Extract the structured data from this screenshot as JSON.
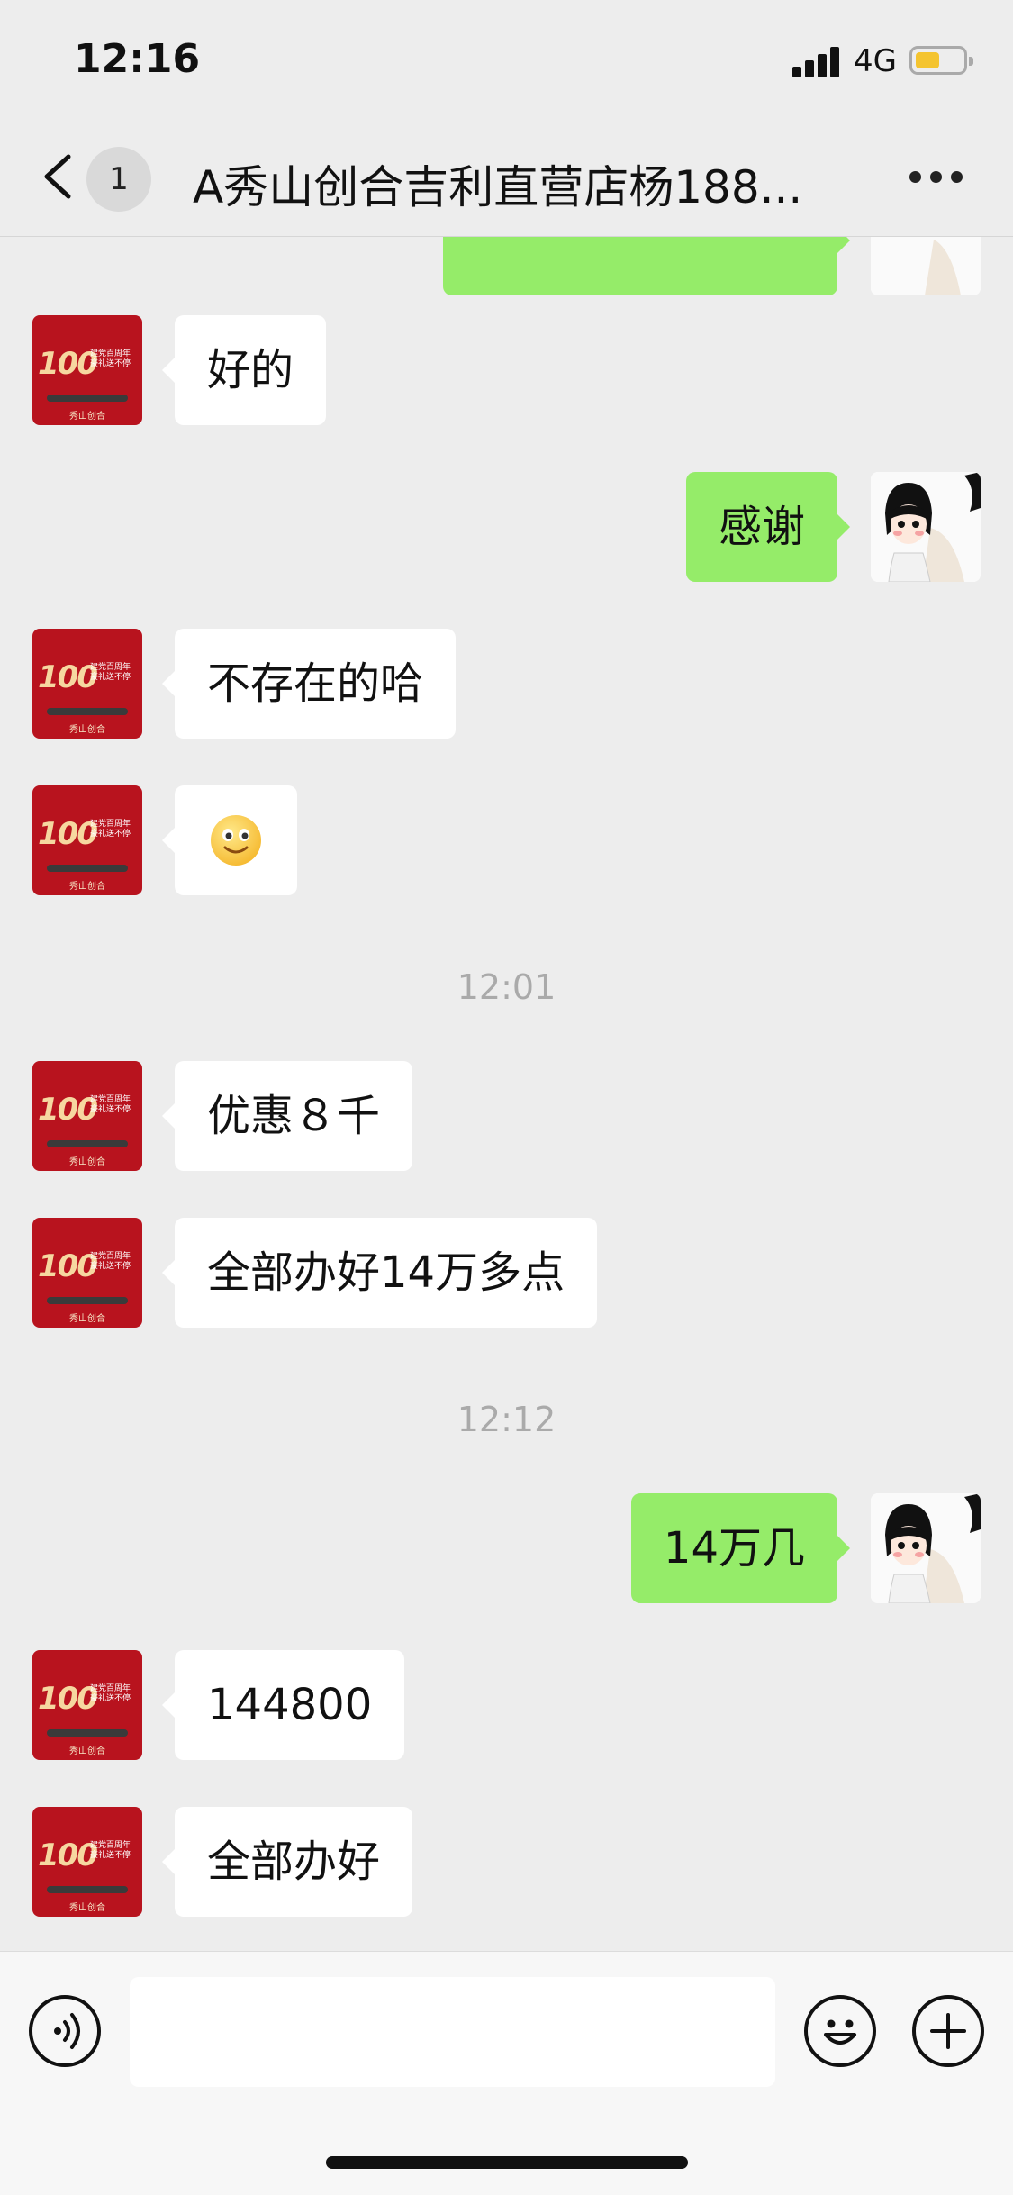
{
  "status_bar": {
    "time": "12:16",
    "network": "4G",
    "battery_level": 0.5
  },
  "header": {
    "unread_count": "1",
    "title": "A秀山创合吉利直营店杨188..."
  },
  "store_avatar": {
    "logo_number": "100",
    "tagline": "建党百周年 豪礼送不停",
    "footer": "秀山创合"
  },
  "messages": [
    {
      "side": "left",
      "text": "好的"
    },
    {
      "side": "right",
      "text": "感谢"
    },
    {
      "side": "left",
      "text": "不存在的哈"
    },
    {
      "side": "left",
      "emoji": "smile-emoji"
    },
    {
      "timestamp": "12:01"
    },
    {
      "side": "left",
      "text": "优惠８千"
    },
    {
      "side": "left",
      "text": "全部办好14万多点"
    },
    {
      "timestamp": "12:12"
    },
    {
      "side": "right",
      "text": "14万几"
    },
    {
      "side": "left",
      "text": "144800"
    },
    {
      "side": "left",
      "text": "全部办好"
    }
  ],
  "input_bar": {
    "voice_icon": "voice-icon",
    "emoji_icon": "emoji-icon",
    "plus_icon": "plus-icon",
    "input_value": ""
  },
  "colors": {
    "self_bubble": "#95ec69",
    "other_bubble": "#ffffff",
    "background": "#ededed"
  }
}
